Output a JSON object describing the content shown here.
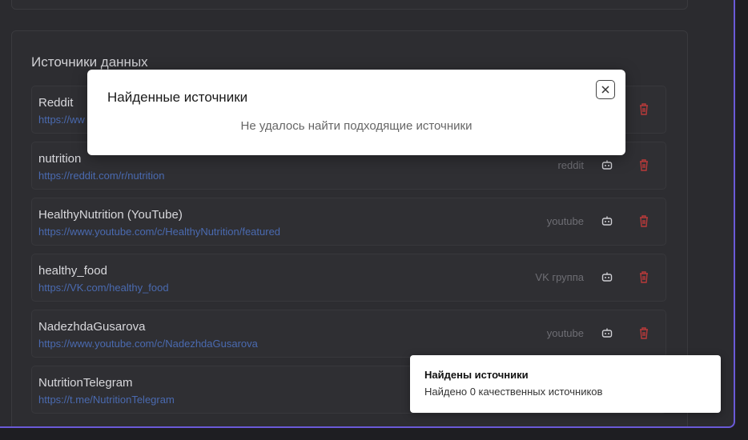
{
  "section": {
    "title": "Источники данных"
  },
  "sources": [
    {
      "name": "Reddit",
      "url": "https://ww",
      "type": ""
    },
    {
      "name": "nutrition",
      "url": "https://reddit.com/r/nutrition",
      "type": "reddit"
    },
    {
      "name": "HealthyNutrition (YouTube)",
      "url": "https://www.youtube.com/c/HealthyNutrition/featured",
      "type": "youtube"
    },
    {
      "name": "healthy_food",
      "url": "https://VK.com/healthy_food",
      "type": "VK группа"
    },
    {
      "name": "NadezhdaGusarova",
      "url": "https://www.youtube.com/c/NadezhdaGusarova",
      "type": "youtube"
    },
    {
      "name": "NutritionTelegram",
      "url": "https://t.me/NutritionTelegram",
      "type": ""
    }
  ],
  "modal": {
    "title": "Найденные источники",
    "message": "Не удалось найти подходящие источники"
  },
  "toast": {
    "title": "Найдены источники",
    "text": "Найдено 0 качественных источников"
  },
  "colors": {
    "accent_border": "#6a5ad8",
    "link": "#4a6ab0",
    "delete": "#b83a3a"
  }
}
